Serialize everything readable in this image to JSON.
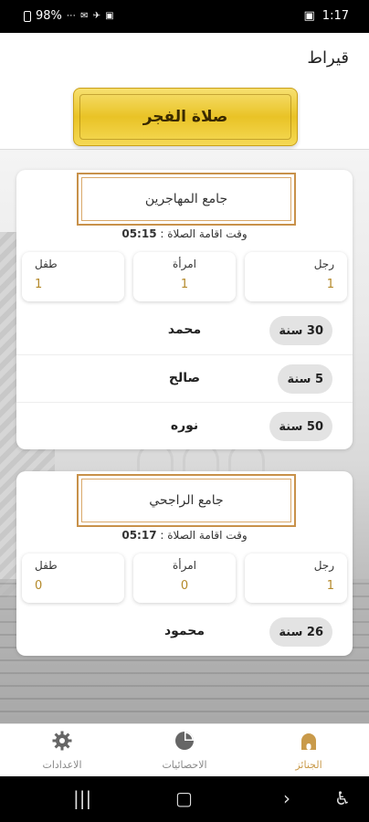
{
  "status_bar": {
    "battery": "98%",
    "time": "1:17"
  },
  "app": {
    "title": "قيراط"
  },
  "prayer": {
    "label": "صلاة الفجر"
  },
  "cards": [
    {
      "mosque": "جامع المهاجرين",
      "iqama_label": "وقت اقامة الصلاة :",
      "iqama_time": "05:15",
      "counts": {
        "man_label": "رجل",
        "man": "1",
        "woman_label": "امرأة",
        "woman": "1",
        "child_label": "طفل",
        "child": "1"
      },
      "people": [
        {
          "name": "محمد",
          "age": "30 سنة"
        },
        {
          "name": "صالح",
          "age": "5 سنة"
        },
        {
          "name": "نوره",
          "age": "50 سنة"
        }
      ]
    },
    {
      "mosque": "جامع الراجحي",
      "iqama_label": "وقت اقامة الصلاة :",
      "iqama_time": "05:17",
      "counts": {
        "man_label": "رجل",
        "man": "1",
        "woman_label": "امرأة",
        "woman": "0",
        "child_label": "طفل",
        "child": "0"
      },
      "people": [
        {
          "name": "محمود",
          "age": "26 سنة"
        }
      ]
    }
  ],
  "bottom_nav": {
    "funerals": "الجنائز",
    "stats": "الاحصائيات",
    "settings": "الاعدادات",
    "active_color": "#c99a4a"
  }
}
